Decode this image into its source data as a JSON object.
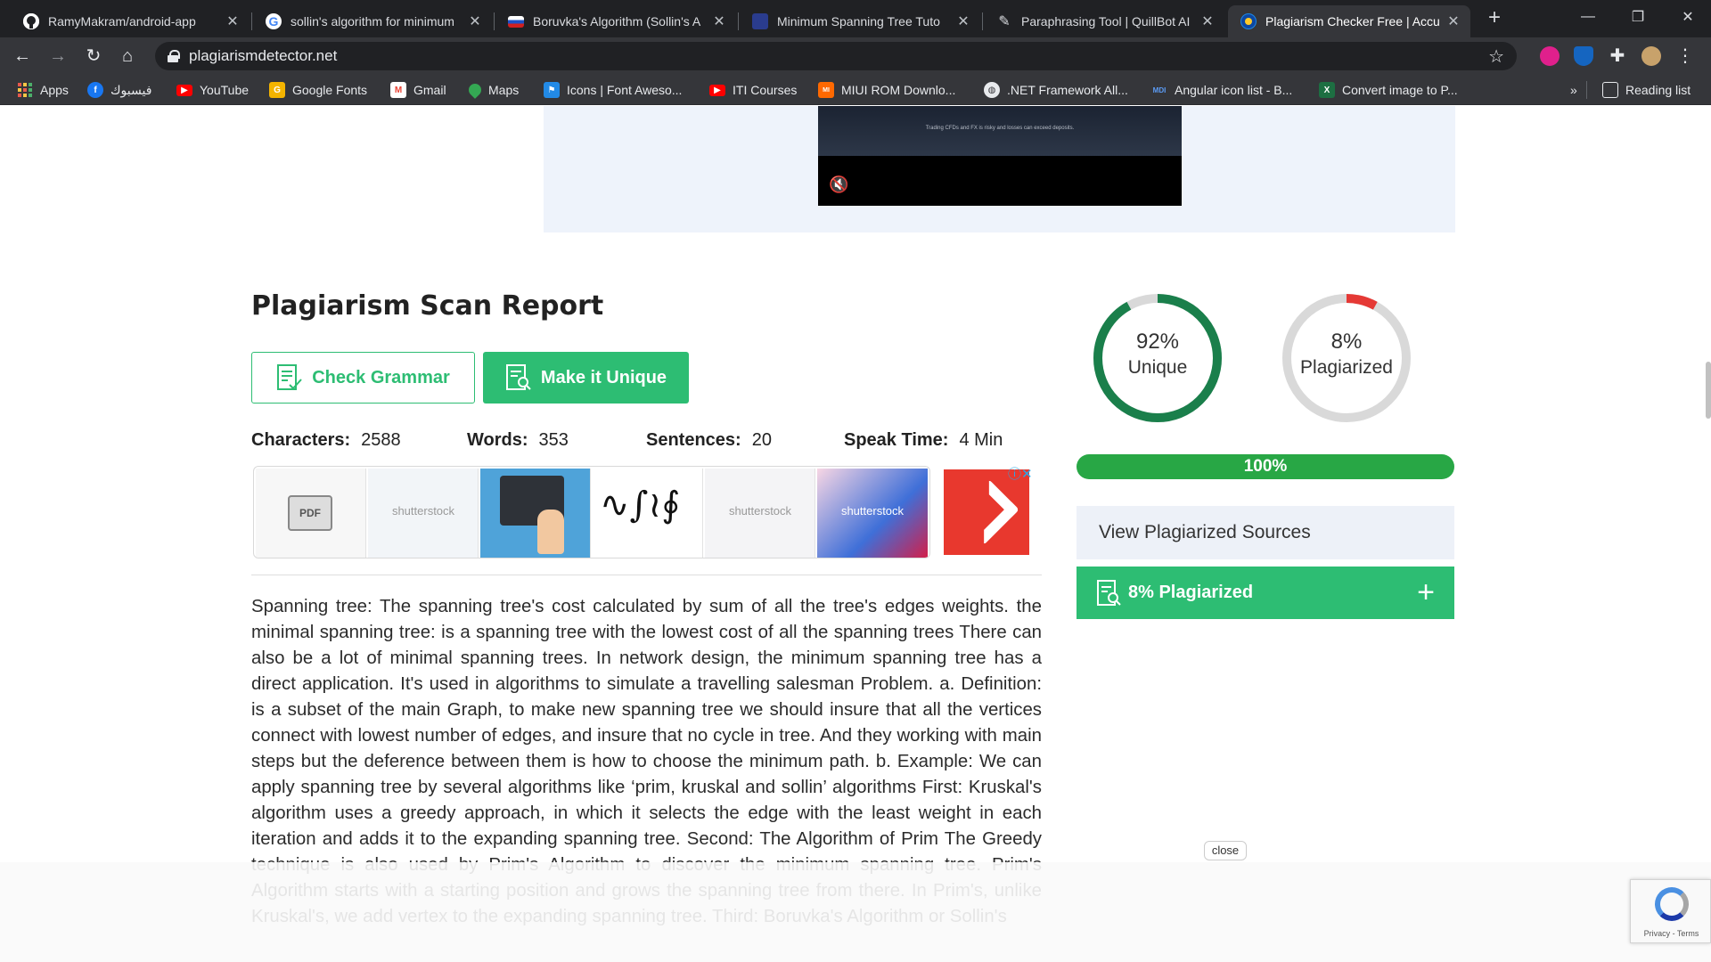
{
  "browser": {
    "tabs": [
      {
        "title": "RamyMakram/android-app",
        "icon": "github-icon",
        "active": false
      },
      {
        "title": "sollin's algorithm for minimum",
        "icon": "google-icon",
        "active": false
      },
      {
        "title": "Boruvka's Algorithm (Sollin's A",
        "icon": "flag-icon",
        "active": false
      },
      {
        "title": "Minimum Spanning Tree Tuto",
        "icon": "tutorial-site-icon",
        "active": false
      },
      {
        "title": "Paraphrasing Tool | QuillBot AI",
        "icon": "quillbot-icon",
        "active": false
      },
      {
        "title": "Plagiarism Checker Free | Accu",
        "icon": "plagiarism-site-icon",
        "active": true
      }
    ],
    "new_tab_symbol": "+",
    "url": "plagiarismdetector.net",
    "bookmarks": [
      {
        "label": "Apps",
        "icon": "apps-grid-icon"
      },
      {
        "label": "فيسبوك",
        "icon": "facebook-icon"
      },
      {
        "label": "YouTube",
        "icon": "youtube-icon"
      },
      {
        "label": "Google Fonts",
        "icon": "google-fonts-icon"
      },
      {
        "label": "Gmail",
        "icon": "gmail-icon"
      },
      {
        "label": "Maps",
        "icon": "maps-icon"
      },
      {
        "label": "Icons | Font Aweso...",
        "icon": "font-awesome-icon"
      },
      {
        "label": "ITI Courses",
        "icon": "youtube-icon"
      },
      {
        "label": "MIUI ROM Downlo...",
        "icon": "miui-icon"
      },
      {
        "label": ".NET Framework All...",
        "icon": "globe-icon"
      },
      {
        "label": "Angular icon list - B...",
        "icon": "mdi-icon"
      },
      {
        "label": "Convert image to P...",
        "icon": "excel-icon"
      }
    ],
    "bookmarks_overflow": "»",
    "reading_list": "Reading list"
  },
  "ad_banner": {
    "video_disclaimer": "Trading CFDs and FX is risky and losses can exceed deposits."
  },
  "report": {
    "title": "Plagiarism Scan Report",
    "check_grammar_label": "Check Grammar",
    "make_unique_label": "Make it Unique",
    "stats": {
      "characters_label": "Characters:",
      "characters": "2588",
      "words_label": "Words:",
      "words": "353",
      "sentences_label": "Sentences:",
      "sentences": "20",
      "speak_time_label": "Speak Time:",
      "speak_time": "4 Min"
    },
    "image_ads": {
      "watermark": "shutterstock",
      "pdf_label": "PDF"
    },
    "body_text": "Spanning tree: The spanning tree's cost calculated by sum of all the tree's edges weights. the minimal spanning tree: is a spanning tree with the lowest cost of all the spanning trees There can also be a lot of minimal spanning trees. In network design, the minimum spanning tree has a direct application. It's used in algorithms to simulate a travelling salesman Problem. a. Definition: is a subset of the main Graph, to make new spanning tree we should insure that all the vertices connect with lowest number of edges, and insure that no cycle in tree. And they working with main steps but the deference between them is how to choose the minimum path. b. Example: We can apply spanning tree by several algorithms like ‘prim, kruskal and sollin’ algorithms First: Kruskal's algorithm uses a greedy approach, in which it selects the edge with the least weight in each iteration and adds it to the expanding spanning tree. Second: The Algorithm of Prim The Greedy technique is also used by Prim's Algorithm to discover the minimum spanning tree. Prim's Algorithm starts with a starting position and grows the spanning tree from there. In Prim's, unlike Kruskal's, we add vertex to the expanding spanning tree. Third: Boruvka's Algorithm or Sollin's"
  },
  "results": {
    "unique": {
      "percent": 92,
      "label_pct": "92%",
      "label": "Unique",
      "color": "#1a7f4b"
    },
    "plagiarized": {
      "percent": 8,
      "label_pct": "8%",
      "label": "Plagiarized",
      "color": "#e53935"
    },
    "ring_track_color": "#d9d9d9",
    "progress_label": "100%",
    "progress_value": 100,
    "view_sources_label": "View Plagiarized Sources",
    "plagiarized_bar_label": "8% Plagiarized",
    "expand_symbol": "+"
  },
  "overlay": {
    "close_label": "close",
    "recaptcha_text": "Privacy - Terms"
  },
  "colors": {
    "brand_green": "#2dbd73",
    "progress_green": "#28a745"
  }
}
